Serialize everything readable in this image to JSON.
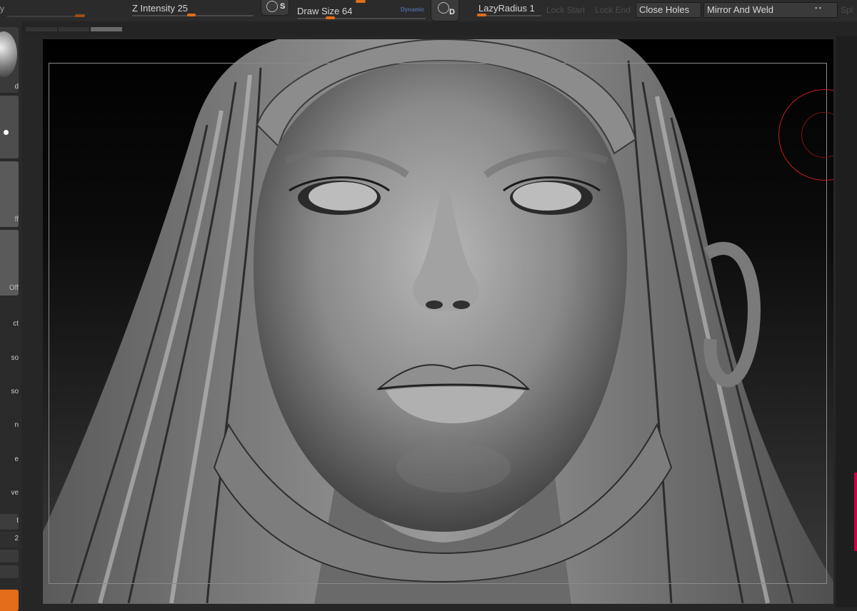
{
  "toolbar": {
    "z_intensity_label": "Z Intensity 25",
    "draw_size_label": "Draw Size 64",
    "dynamic_label": "Dynamic",
    "lazy_radius_label": "LazyRadius 1",
    "lock_start_label": "Lock Start",
    "lock_end_label": "Lock End",
    "close_holes_label": "Close Holes",
    "mirror_weld_label": "Mirror And Weld",
    "truncated_left_label": "y",
    "truncated_right_label": "Spl",
    "s_icon_letter": "S",
    "d_icon_letter": "D"
  },
  "left_panel": {
    "items": [
      {
        "label": "d"
      },
      {
        "label": "ff"
      },
      {
        "label": "Off"
      },
      {
        "label": "ct"
      },
      {
        "label": "so"
      },
      {
        "label": "so"
      },
      {
        "label": "n"
      },
      {
        "label": "e"
      },
      {
        "label": "ve"
      },
      {
        "label": "t"
      },
      {
        "label": "2"
      }
    ]
  },
  "colors": {
    "accent": "#e36d1a",
    "brush_cursor": "#c81e1e",
    "right_edge_marker": "#cc0044"
  },
  "sliders": {
    "z_intensity": 25,
    "draw_size": 64,
    "lazy_radius": 1
  }
}
